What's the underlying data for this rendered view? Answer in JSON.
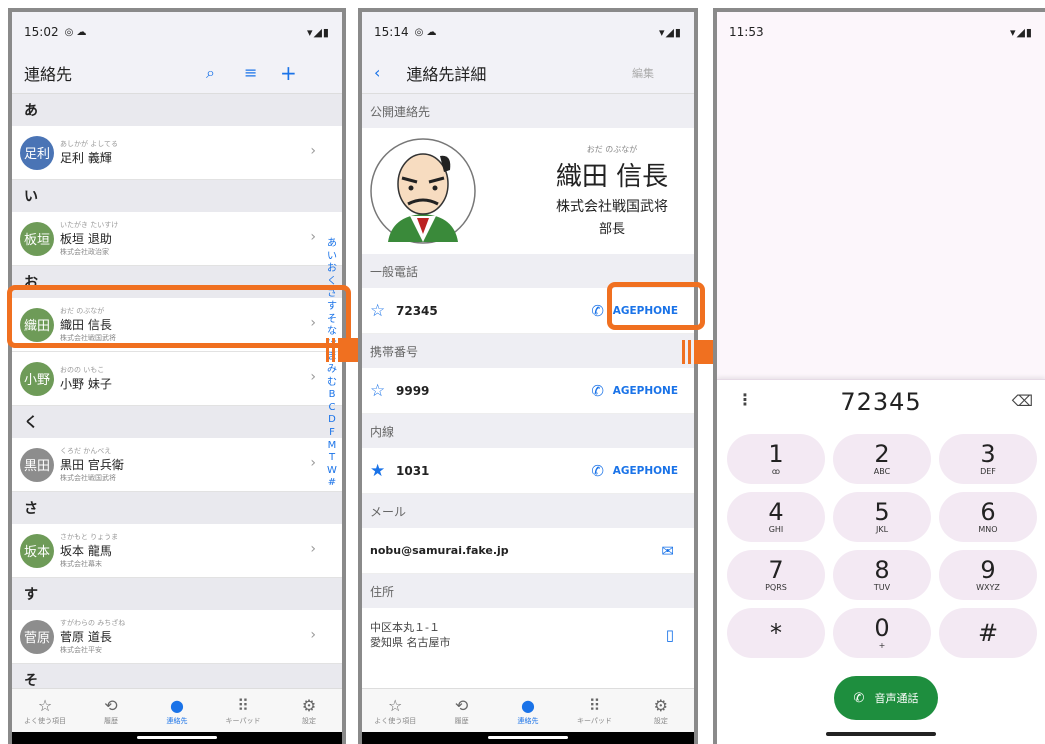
{
  "screen1": {
    "status": {
      "time": "15:02"
    },
    "nav": {
      "title": "連絡先"
    },
    "sections": [
      {
        "header": "あ",
        "rows": [
          {
            "avatar": "足利",
            "ruby": "あしかが よしてる",
            "name": "足利 義輝",
            "company": "",
            "color": "blue"
          }
        ]
      },
      {
        "header": "い",
        "rows": [
          {
            "avatar": "板垣",
            "ruby": "いたがき たいすけ",
            "name": "板垣 退助",
            "company": "株式会社政治家",
            "color": "green"
          }
        ]
      },
      {
        "header": "お",
        "rows": [
          {
            "avatar": "織田",
            "ruby": "おだ のぶなが",
            "name": "織田 信長",
            "company": "株式会社戦国武将",
            "color": "green"
          },
          {
            "avatar": "小野",
            "ruby": "おのの いもこ",
            "name": "小野 妹子",
            "company": "",
            "color": "green"
          }
        ]
      },
      {
        "header": "く",
        "rows": [
          {
            "avatar": "黒田",
            "ruby": "くろだ かんべえ",
            "name": "黒田 官兵衛",
            "company": "株式会社戦国武将",
            "color": "gray"
          }
        ]
      },
      {
        "header": "さ",
        "rows": [
          {
            "avatar": "坂本",
            "ruby": "さかもと りょうま",
            "name": "坂本 龍馬",
            "company": "株式会社幕末",
            "color": "green"
          }
        ]
      },
      {
        "header": "す",
        "rows": [
          {
            "avatar": "菅原",
            "ruby": "すがわらの みちざね",
            "name": "菅原 道長",
            "company": "株式会社平安",
            "color": "gray"
          }
        ]
      },
      {
        "header": "そ",
        "rows": []
      }
    ],
    "index": [
      "あ",
      "い",
      "お",
      "く",
      "さ",
      "す",
      "そ",
      "な",
      "は",
      "ま",
      "み",
      "む",
      "B",
      "C",
      "D",
      "F",
      "M",
      "T",
      "W",
      "#"
    ]
  },
  "tabs": [
    {
      "label": "よく使う項目",
      "icon": "star-icon",
      "glyph": "☆"
    },
    {
      "label": "履歴",
      "icon": "history-icon",
      "glyph": "⟲"
    },
    {
      "label": "連絡先",
      "icon": "person-icon",
      "glyph": "●"
    },
    {
      "label": "キーパッド",
      "icon": "keypad-icon",
      "glyph": "⠿"
    },
    {
      "label": "設定",
      "icon": "gear-icon",
      "glyph": "⚙"
    }
  ],
  "screen2": {
    "status": {
      "time": "15:14"
    },
    "nav": {
      "title": "連絡先詳細",
      "edit": "編集"
    },
    "public_label": "公開連絡先",
    "profile": {
      "ruby": "おだ のぶなが",
      "name": "織田 信長",
      "company": "株式会社戦国武将",
      "title": "部長"
    },
    "phones": [
      {
        "section": "一般電話",
        "number": "72345",
        "action": "AGEPHONE",
        "starred": false
      },
      {
        "section": "携帯番号",
        "number": "9999",
        "action": "AGEPHONE",
        "starred": false
      },
      {
        "section": "内線",
        "number": "1031",
        "action": "AGEPHONE",
        "starred": true
      }
    ],
    "mail_label": "メール",
    "mail": "nobu@samurai.fake.jp",
    "address_label": "住所",
    "address_line1": "中区本丸１-１",
    "address_line2": "愛知県 名古屋市"
  },
  "screen3": {
    "status": {
      "time": "11:53"
    },
    "dial_number": "72345",
    "keys": [
      {
        "d": "1",
        "l": "ꝏ"
      },
      {
        "d": "2",
        "l": "ABC"
      },
      {
        "d": "3",
        "l": "DEF"
      },
      {
        "d": "4",
        "l": "GHI"
      },
      {
        "d": "5",
        "l": "JKL"
      },
      {
        "d": "6",
        "l": "MNO"
      },
      {
        "d": "7",
        "l": "PQRS"
      },
      {
        "d": "8",
        "l": "TUV"
      },
      {
        "d": "9",
        "l": "WXYZ"
      },
      {
        "d": "*",
        "l": ""
      },
      {
        "d": "0",
        "l": "+"
      },
      {
        "d": "#",
        "l": ""
      }
    ],
    "call_label": "音声通話"
  },
  "colors": {
    "accent": "#1a73e8",
    "highlight": "#f07020",
    "call_green": "#1e8e3e",
    "keypad_bg": "#f3e9f3"
  }
}
